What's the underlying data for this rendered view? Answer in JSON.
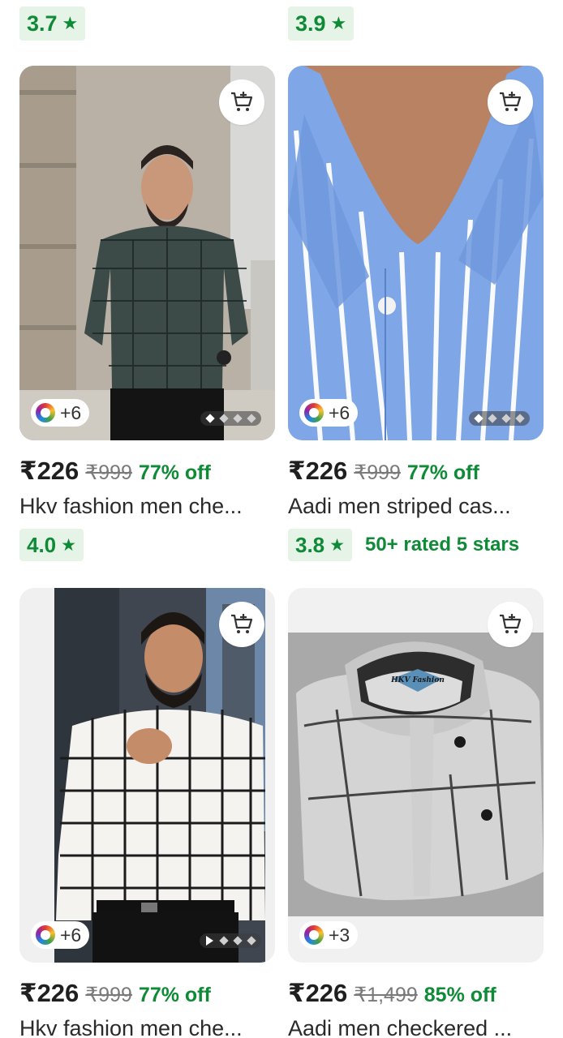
{
  "top_ratings": [
    {
      "value": "3.7",
      "star": "★"
    },
    {
      "value": "3.9",
      "star": "★"
    }
  ],
  "products": [
    {
      "image_desc": "man in dark green checkered shirt",
      "variants": "+6",
      "price": "₹226",
      "mrp": "₹999",
      "discount": "77% off",
      "title": "Hkv fashion men che...",
      "rating": "4.0",
      "star": "★",
      "rated_note": ""
    },
    {
      "image_desc": "blue and white striped shirt collar",
      "variants": "+6",
      "price": "₹226",
      "mrp": "₹999",
      "discount": "77% off",
      "title": "Aadi men striped cas...",
      "rating": "3.8",
      "star": "★",
      "rated_note": "50+ rated 5 stars"
    },
    {
      "image_desc": "man in white black checkered shirt",
      "variants": "+6",
      "price": "₹226",
      "mrp": "₹999",
      "discount": "77% off",
      "title": "Hkv fashion men che..."
    },
    {
      "image_desc": "folded grey checkered shirt",
      "logo_text": "HKV Fashion",
      "variants": "+3",
      "price": "₹226",
      "mrp": "₹1,499",
      "discount": "85% off",
      "title": "Aadi men checkered ..."
    }
  ],
  "colors": {
    "accent_green": "#0f8a36",
    "rating_bg": "#e6f4e8"
  },
  "icons": [
    "add-to-cart-icon",
    "star-icon",
    "color-variants-icon"
  ]
}
